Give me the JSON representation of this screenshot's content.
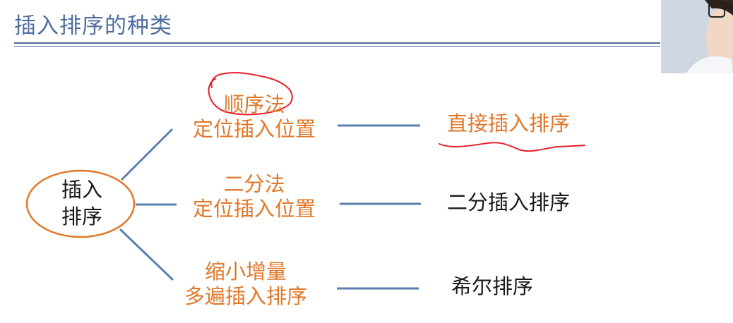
{
  "slide": {
    "title": "插入排序的种类"
  },
  "diagram": {
    "center": {
      "line1": "插入",
      "line2": "排序"
    },
    "branches": [
      {
        "method_line1": "顺序法",
        "method_line2": "定位插入位置",
        "result": "直接插入排序"
      },
      {
        "method_line1": "二分法",
        "method_line2": "定位插入位置",
        "result": "二分插入排序"
      },
      {
        "method_line1": "缩小增量",
        "method_line2": "多遍插入排序",
        "result": "希尔排序"
      }
    ]
  },
  "colors": {
    "title": "#4f6e9e",
    "connector": "#5b7fb0",
    "method_text": "#e0782a",
    "ellipse_stroke": "#e0782a",
    "annotation": "#e8202a"
  }
}
